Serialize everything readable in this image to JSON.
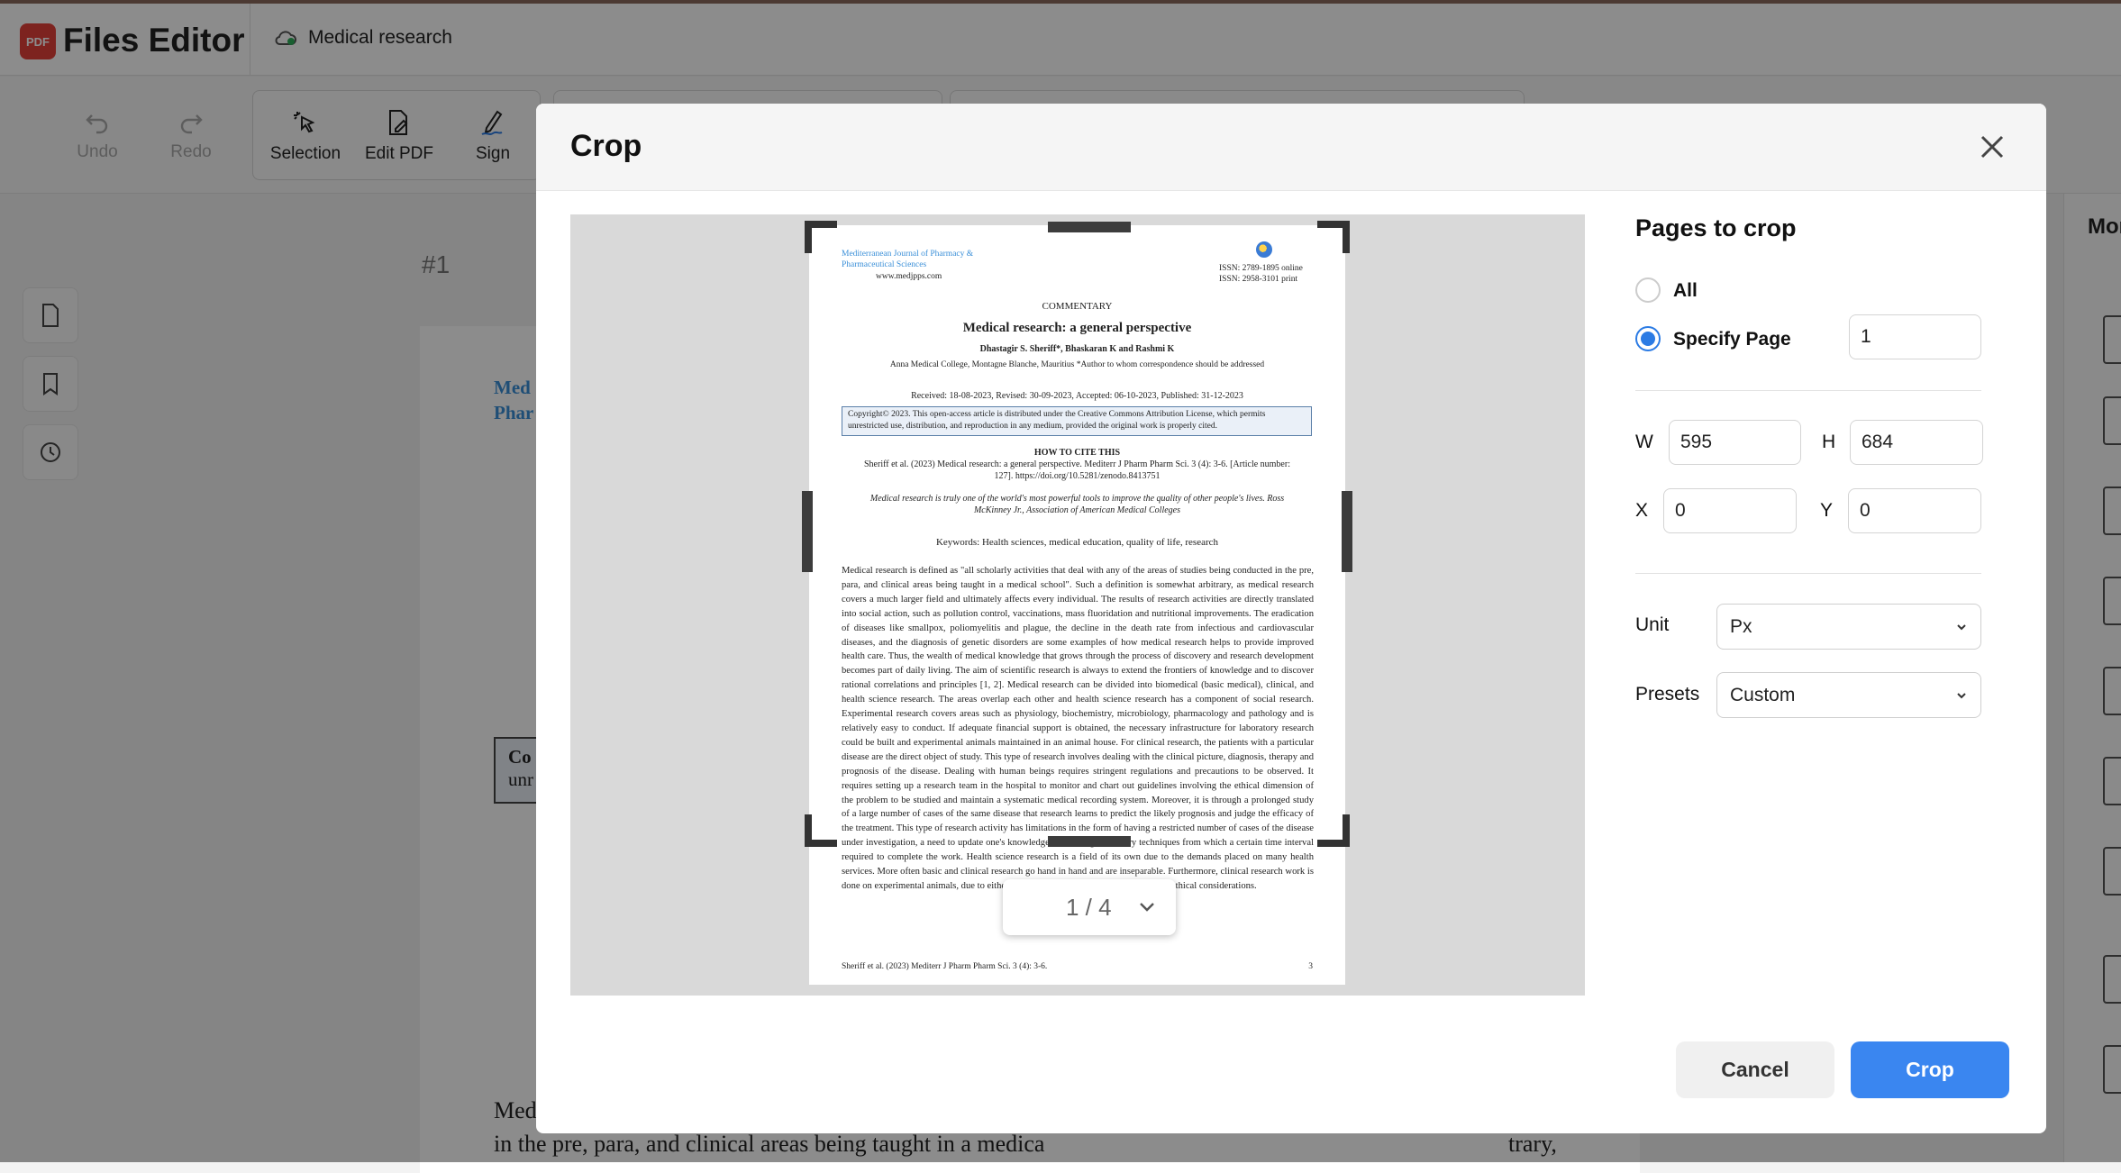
{
  "app": {
    "logo_text": "PDF",
    "name": "Files Editor",
    "document_name": "Medical research"
  },
  "toolbar": {
    "undo": "Undo",
    "redo": "Redo",
    "selection": "Selection",
    "edit_pdf": "Edit PDF",
    "sign": "Sign"
  },
  "background": {
    "page_number": "#1",
    "text_med": "Med",
    "text_phar": "Phar",
    "text_co": "Co",
    "text_unr": "unr",
    "line1": "Med",
    "line2": "in the pre, para, and clinical areas being taught in a medica",
    "line2_end": "trary,",
    "right_more": "Mor"
  },
  "dialog": {
    "title": "Crop",
    "pages_to_crop": "Pages to crop",
    "option_all": "All",
    "option_specify": "Specify Page",
    "page_value": "1",
    "w_label": "W",
    "w_value": "595",
    "h_label": "H",
    "h_value": "684",
    "x_label": "X",
    "x_value": "0",
    "y_label": "Y",
    "y_value": "0",
    "unit_label": "Unit",
    "unit_value": "Px",
    "presets_label": "Presets",
    "presets_value": "Custom",
    "cancel": "Cancel",
    "crop": "Crop",
    "pager": "1 / 4"
  },
  "pdf": {
    "journal": "Mediterranean Journal of Pharmacy & Pharmaceutical Sciences",
    "url": "www.medjpps.com",
    "issn": "ISSN: 2789-1895 online ISSN: 2958-3101 print",
    "commentary": "COMMENTARY",
    "title": "Medical research: a general perspective",
    "authors": "Dhastagir S. Sheriff*, Bhaskaran K and Rashmi K",
    "affiliation": "Anna Medical College, Montagne Blanche, Mauritius *Author to whom correspondence should be addressed",
    "received": "Received: 18-08-2023, Revised: 30-09-2023, Accepted: 06-10-2023, Published: 31-12-2023",
    "copyright": "Copyright© 2023. This open-access article is distributed under the Creative Commons Attribution License, which permits unrestricted use, distribution, and reproduction in any medium, provided the original work is properly cited.",
    "cite_head": "HOW TO CITE THIS",
    "cite": "Sheriff et al. (2023) Medical research: a general perspective. Mediterr J Pharm Pharm Sci. 3 (4): 3-6. [Article number: 127]. https://doi.org/10.5281/zenodo.8413751",
    "quote": "Medical research is truly one of the world's most powerful tools to improve the quality of other people's lives. Ross McKinney Jr., Association of American Medical Colleges",
    "keywords": "Keywords: Health sciences, medical education, quality of life, research",
    "body": "Medical research is defined as \"all scholarly activities that deal with any of the areas of studies being conducted in the pre, para, and clinical areas being taught in a medical school\". Such a definition is somewhat arbitrary, as medical research covers a much larger field and ultimately affects every individual. The results of research activities are directly translated into social action, such as pollution control, vaccinations, mass fluoridation and nutritional improvements. The eradication of diseases like smallpox, poliomyelitis and plague, the decline in the death rate from infectious and cardiovascular diseases, and the diagnosis of genetic disorders are some examples of how medical research helps to provide improved health care. Thus, the wealth of medical knowledge that grows through the process of discovery and research development becomes part of daily living. The aim of scientific research is always to extend the frontiers of knowledge and to discover rational correlations and principles [1, 2]. Medical research can be divided into biomedical (basic medical), clinical, and health science research. The areas overlap each other and health science research has a component of social research. Experimental research covers areas such as physiology, biochemistry, microbiology, pharmacology and pathology and is relatively easy to conduct. If adequate financial support is obtained, the necessary infrastructure for laboratory research could be built and experimental animals maintained in an animal house. For clinical research, the patients with a particular disease are the direct object of study. This type of research involves dealing with the clinical picture, diagnosis, therapy and prognosis of the disease. Dealing with human beings requires stringent regulations and precautions to be observed. It requires setting up a research team in the hospital to monitor and chart out guidelines involving the ethical dimension of the problem to be studied and maintain a systematic medical recording system. Moreover, it is through a prolonged study of a large number of cases of the same disease that research learns to predict the likely prognosis and judge the efficacy of the treatment. This type of research activity has limitations in the form of having a restricted number of cases of the disease under investigation, a need to update one's knowledge concerning laboratory techniques from which a certain time interval required to complete the work. Health science research is a field of its own due to the demands placed on many health services. More often basic and clinical research go hand in hand and are inseparable. Furthermore, clinical research work is done on experimental animals, due to either the limited number of human cases or for ethical considerations.",
    "footer": "Sheriff et al. (2023) Mediterr J Pharm Pharm Sci. 3 (4): 3-6.",
    "page": "3"
  }
}
